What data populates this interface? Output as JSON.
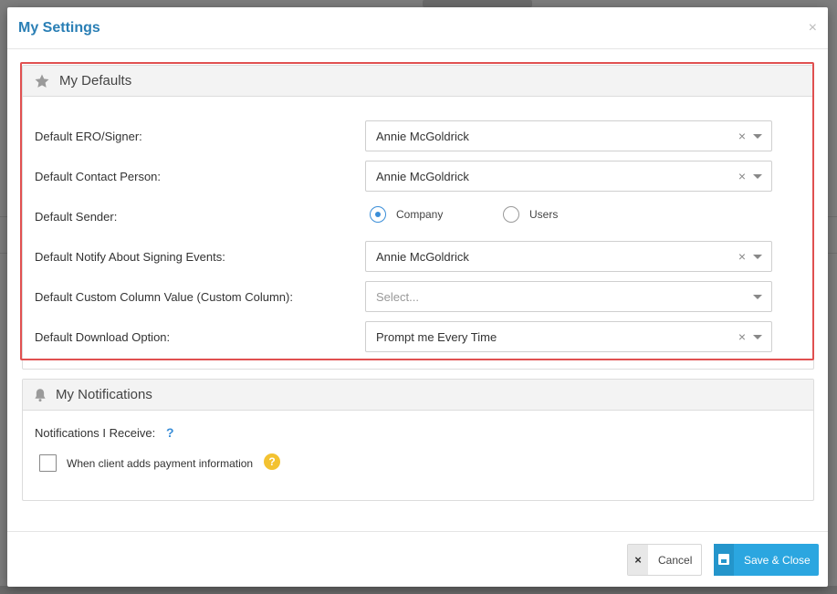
{
  "modal": {
    "title": "My Settings",
    "close_glyph": "×"
  },
  "defaults": {
    "heading": "My Defaults",
    "heading_icon": "star-icon",
    "rows": {
      "ero_signer": {
        "label": "Default ERO/Signer:",
        "value": "Annie McGoldrick"
      },
      "contact_person": {
        "label": "Default Contact Person:",
        "value": "Annie McGoldrick"
      },
      "sender": {
        "label": "Default Sender:",
        "options": [
          {
            "label": "Company",
            "selected": true
          },
          {
            "label": "Users",
            "selected": false
          }
        ]
      },
      "notify_signing": {
        "label": "Default Notify About Signing Events:",
        "value": "Annie McGoldrick"
      },
      "custom_column": {
        "label": "Default Custom Column Value (Custom Column):",
        "placeholder": "Select..."
      },
      "download_option": {
        "label": "Default Download Option:",
        "value": "Prompt me Every Time"
      }
    }
  },
  "notifications": {
    "heading": "My Notifications",
    "heading_icon": "bell-icon",
    "receive_label": "Notifications I Receive:",
    "help_glyph": "?",
    "payment_checkbox": {
      "label": "When client adds payment information",
      "checked": false
    },
    "info_glyph": "?"
  },
  "footer": {
    "cancel_label": "Cancel",
    "cancel_glyph": "×",
    "save_label": "Save & Close"
  },
  "colors": {
    "title_blue": "#2a7fb5",
    "highlight_red": "#e05050",
    "save_blue": "#2ba6e0",
    "info_yellow": "#f3c231"
  }
}
